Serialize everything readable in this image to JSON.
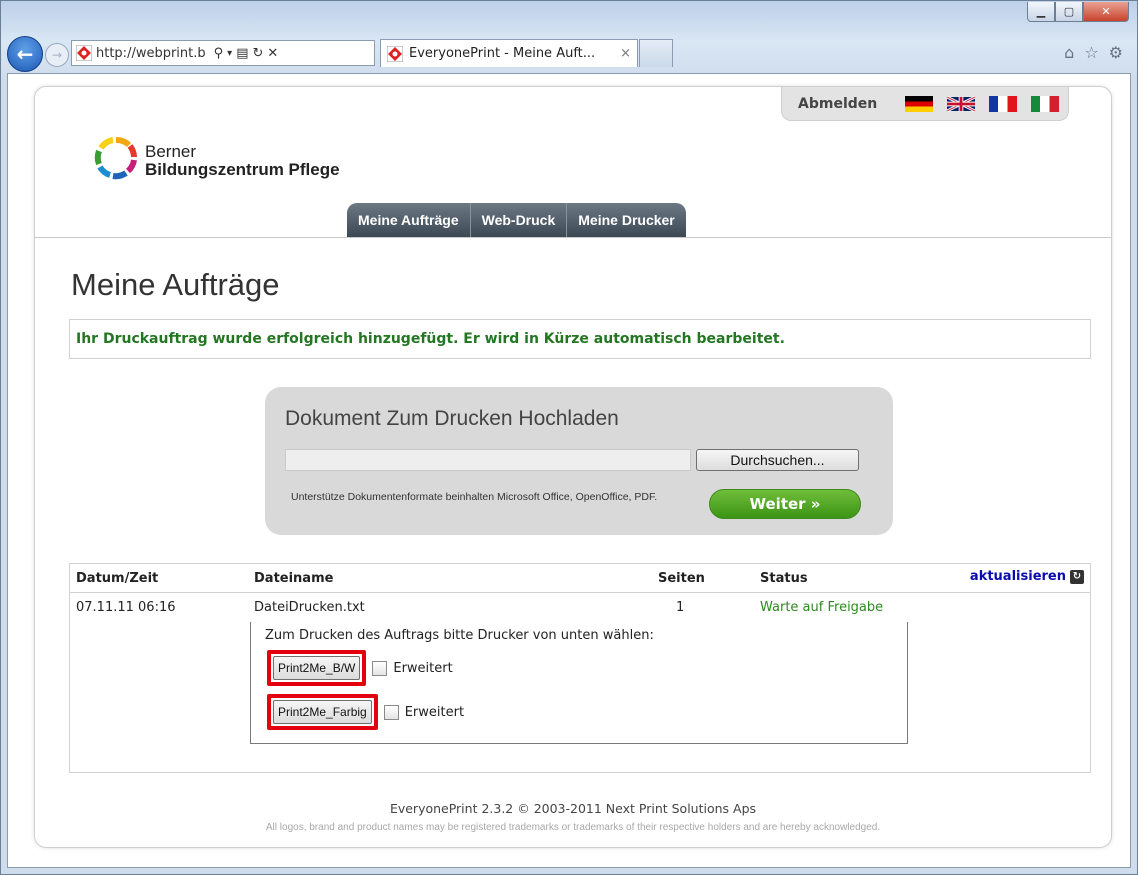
{
  "browser": {
    "address": "http://webprint.b",
    "tab_title": "EveryonePrint - Meine Auft...",
    "tab_close": "×"
  },
  "header": {
    "logout": "Abmelden",
    "logo_line1": "Berner",
    "logo_line2": "Bildungszentrum Pflege",
    "nav": [
      "Meine Aufträge",
      "Web-Druck",
      "Meine Drucker"
    ]
  },
  "page": {
    "title": "Meine Aufträge",
    "success_message": "Ihr Druckauftrag wurde erfolgreich hinzugefügt. Er wird in Kürze automatisch bearbeitet."
  },
  "upload": {
    "title": "Dokument Zum Drucken Hochladen",
    "browse_label": "Durchsuchen...",
    "formats_text": "Unterstütze Dokumentenformate beinhalten Microsoft Office, OpenOffice, PDF.",
    "next_label": "Weiter »"
  },
  "jobs": {
    "headers": {
      "date": "Datum/Zeit",
      "file": "Dateiname",
      "pages": "Seiten",
      "status": "Status"
    },
    "refresh_label": "aktualisieren",
    "rows": [
      {
        "date": "07.11.11 06:16",
        "file": "DateiDrucken.txt",
        "pages": "1",
        "status": "Warte auf Freigabe"
      }
    ],
    "printer_note": "Zum Drucken des Auftrags bitte Drucker von unten wählen:",
    "printers": [
      {
        "name": "Print2Me_B/W",
        "option": "Erweitert"
      },
      {
        "name": "Print2Me_Farbig",
        "option": "Erweitert"
      }
    ]
  },
  "footer": {
    "line1": "EveryonePrint 2.3.2 © 2003-2011 Next Print Solutions Aps",
    "line2": "All logos, brand and product names may be registered trademarks or trademarks of their respective holders and are hereby acknowledged."
  },
  "colors": {
    "success_green": "#237622",
    "status_green": "#2c8a1e",
    "button_green": "#4fa524",
    "highlight_red": "#e3000f",
    "nav_dark": "#3c4853",
    "link_blue": "#0b0bb0"
  }
}
